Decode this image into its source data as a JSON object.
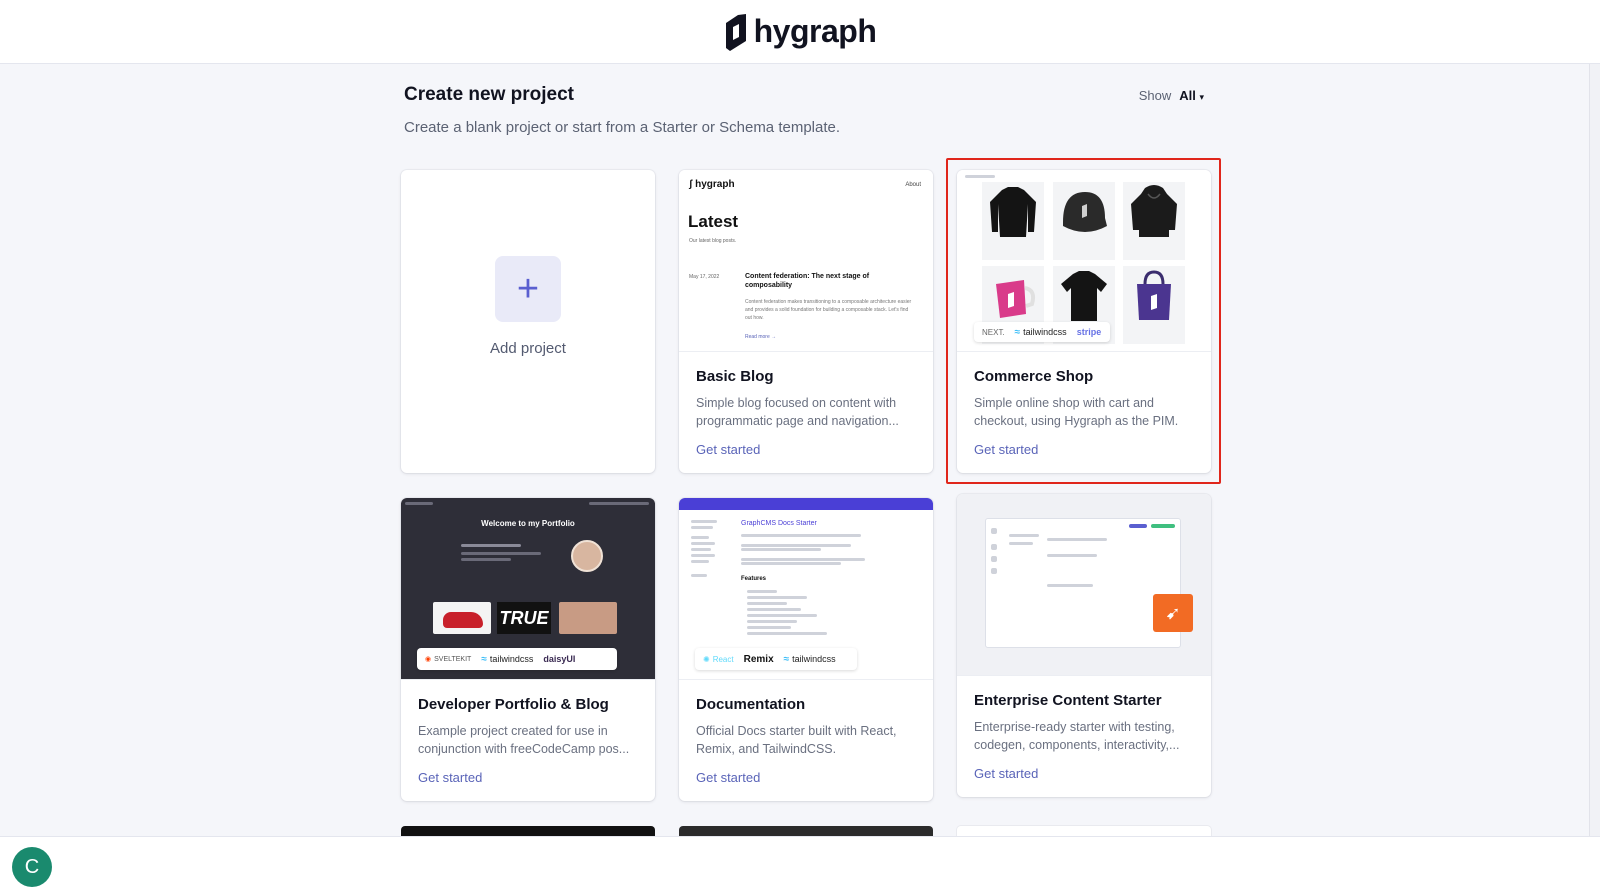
{
  "app": {
    "brand": "hygraph"
  },
  "header": {
    "title": "Create new project",
    "subtitle": "Create a blank project or start from a Starter or Schema template.",
    "show_label": "Show",
    "show_value": "All"
  },
  "add_project": {
    "label": "Add project"
  },
  "cards": [
    {
      "title": "Basic Blog",
      "description": "Simple blog focused on content with programmatic page and navigation...",
      "cta": "Get started",
      "thumb": {
        "brand": "hygraph",
        "nav": "About",
        "heading": "Latest",
        "tagline": "Our latest blog posts.",
        "date": "May 17, 2022",
        "post_title": "Content federation: The next stage of composability",
        "post_excerpt": "Content federation makes transitioning to a composable architecture easier and provides a solid foundation for building a composable stack. Let's find out how.",
        "read_more": "Read more →"
      }
    },
    {
      "title": "Commerce Shop",
      "description": "Simple online shop with cart and checkout, using Hygraph as the PIM.",
      "cta": "Get started",
      "thumb": {
        "tech": [
          "NEXT.",
          "tailwindcss",
          "stripe"
        ]
      }
    },
    {
      "title": "Developer Portfolio & Blog",
      "description": "Example project created for use in conjunction with freeCodeCamp pos...",
      "cta": "Get started",
      "thumb": {
        "heading": "Welcome to my Portfolio",
        "tech": [
          "SVELTEKIT",
          "tailwindcss",
          "daisyUI"
        ]
      }
    },
    {
      "title": "Documentation",
      "description": "Official Docs starter built with React, Remix, and TailwindCSS.",
      "cta": "Get started",
      "thumb": {
        "heading": "GraphCMS Docs Starter",
        "section": "Features",
        "tech": [
          "React",
          "Remix",
          "tailwindcss"
        ]
      }
    },
    {
      "title": "Enterprise Content Starter",
      "description": "Enterprise-ready starter with testing, codegen, components, interactivity,...",
      "cta": "Get started"
    }
  ],
  "user": {
    "initial": "C"
  },
  "colors": {
    "accent": "#5a64b8",
    "highlight": "#e0261b",
    "avatar": "#1a8a6e",
    "docs_header": "#4a3fd6",
    "portfolio_bg": "#2e2e38",
    "enterprise_icon": "#f26b24"
  }
}
